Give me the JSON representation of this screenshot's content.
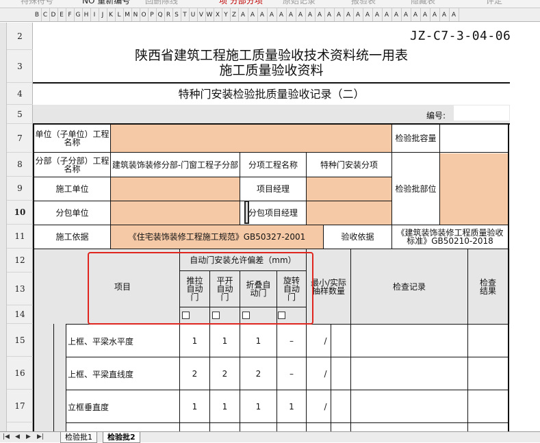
{
  "toolbar": {
    "items": [
      "特殊符号",
      "NO 重新编号",
      "回删除线",
      "项 分部分项",
      "原始记录",
      "报验表",
      "隐藏表",
      "评定"
    ]
  },
  "column_header": [
    "B",
    "C",
    "D",
    "E",
    "F",
    "G",
    "H",
    "I",
    "J",
    "K",
    "L",
    "M",
    "N",
    "O",
    "P",
    "Q",
    "R",
    "S",
    "T",
    "U",
    "V",
    "W",
    "X",
    "Y",
    "Z",
    "A",
    "A",
    "A",
    "A",
    "A",
    "A",
    "A",
    "A",
    "A",
    "A",
    "A",
    "A",
    "A",
    "A",
    "A",
    "A",
    "A",
    "A",
    "A",
    "A",
    "A",
    "A",
    "A"
  ],
  "row_numbers": [
    "2",
    "3",
    "4",
    "5",
    "7",
    "8",
    "9",
    "10",
    "11",
    "12",
    "13",
    "14",
    "15",
    "16",
    "17"
  ],
  "form": {
    "code": "JZ-C7-3-04-06",
    "title_line1": "陕西省建筑工程施工质量验收技术资料统一用表",
    "title_line2": "施工质量验收资料",
    "subtitle": "特种门安装检验批质量验收记录（二）",
    "number_label": "编号:",
    "unit_label": "单位（子单位）工程名称",
    "batch_capacity_label": "检验批容量",
    "subdivision_label": "分部（子分部）工程名称",
    "subdivision_value": "建筑装饰装修分部-门窗工程子分部",
    "item_project_label": "分项工程名称",
    "item_project_value": "特种门安装分项",
    "construction_unit_label": "施工单位",
    "project_manager_label": "项目经理",
    "batch_part_label": "检验批部位",
    "subcontract_unit_label": "分包单位",
    "subcontract_manager_label": "分包项目经理",
    "construction_basis_label": "施工依据",
    "construction_basis_value": "《住宅装饰装修工程施工规范》GB50327-2001",
    "acceptance_basis_label": "验收依据",
    "acceptance_basis_value": "《建筑装饰装修工程质量验收标准》GB50210-2018",
    "deviation_header": "自动门安装允许偏差（mm）",
    "item_label": "项目",
    "door_types": [
      "推拉自动门",
      "平开自动门",
      "折叠自动门",
      "旋转自动门"
    ],
    "sampling_label": "最小/实际抽样数量",
    "inspection_record_label": "检查记录",
    "inspection_result_label": "检查结果",
    "rows": [
      {
        "name": "上框、平梁水平度",
        "values": [
          "1",
          "1",
          "1",
          "–"
        ],
        "slash": "/"
      },
      {
        "name": "上框、平梁直线度",
        "values": [
          "2",
          "2",
          "2",
          "–"
        ],
        "slash": "/"
      },
      {
        "name": "立框垂直度",
        "values": [
          "1",
          "1",
          "1",
          "1"
        ],
        "slash": "/"
      }
    ]
  },
  "tabs": [
    "检验批1",
    "检验批2"
  ],
  "tab_nav": [
    "|◀",
    "◀",
    "▶",
    "▶|"
  ]
}
